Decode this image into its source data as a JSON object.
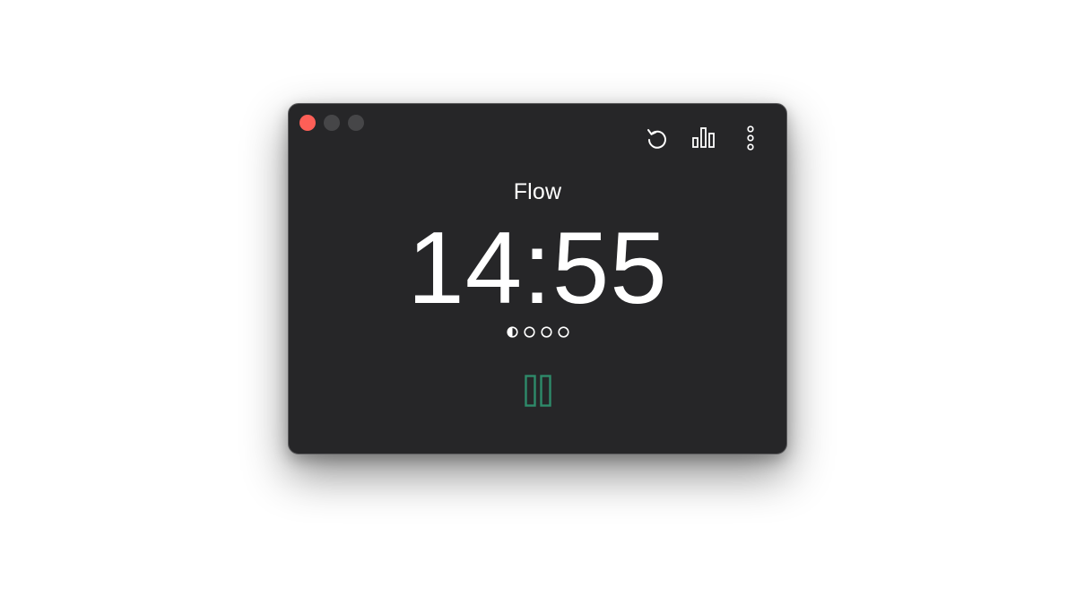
{
  "window": {
    "controls": [
      "close",
      "minimize",
      "zoom"
    ]
  },
  "toolbar": {
    "reset_icon": "reset-icon",
    "stats_icon": "bar-chart-icon",
    "menu_icon": "more-vertical-icon"
  },
  "timer": {
    "mode": "Flow",
    "time": "14:55",
    "sessions_total": 4,
    "sessions_current_progress": 0.5,
    "control_icon": "pause-icon"
  },
  "colors": {
    "window_bg": "#262628",
    "close": "#fe5f57",
    "accent": "#2e8b6a",
    "text": "#ffffff"
  }
}
